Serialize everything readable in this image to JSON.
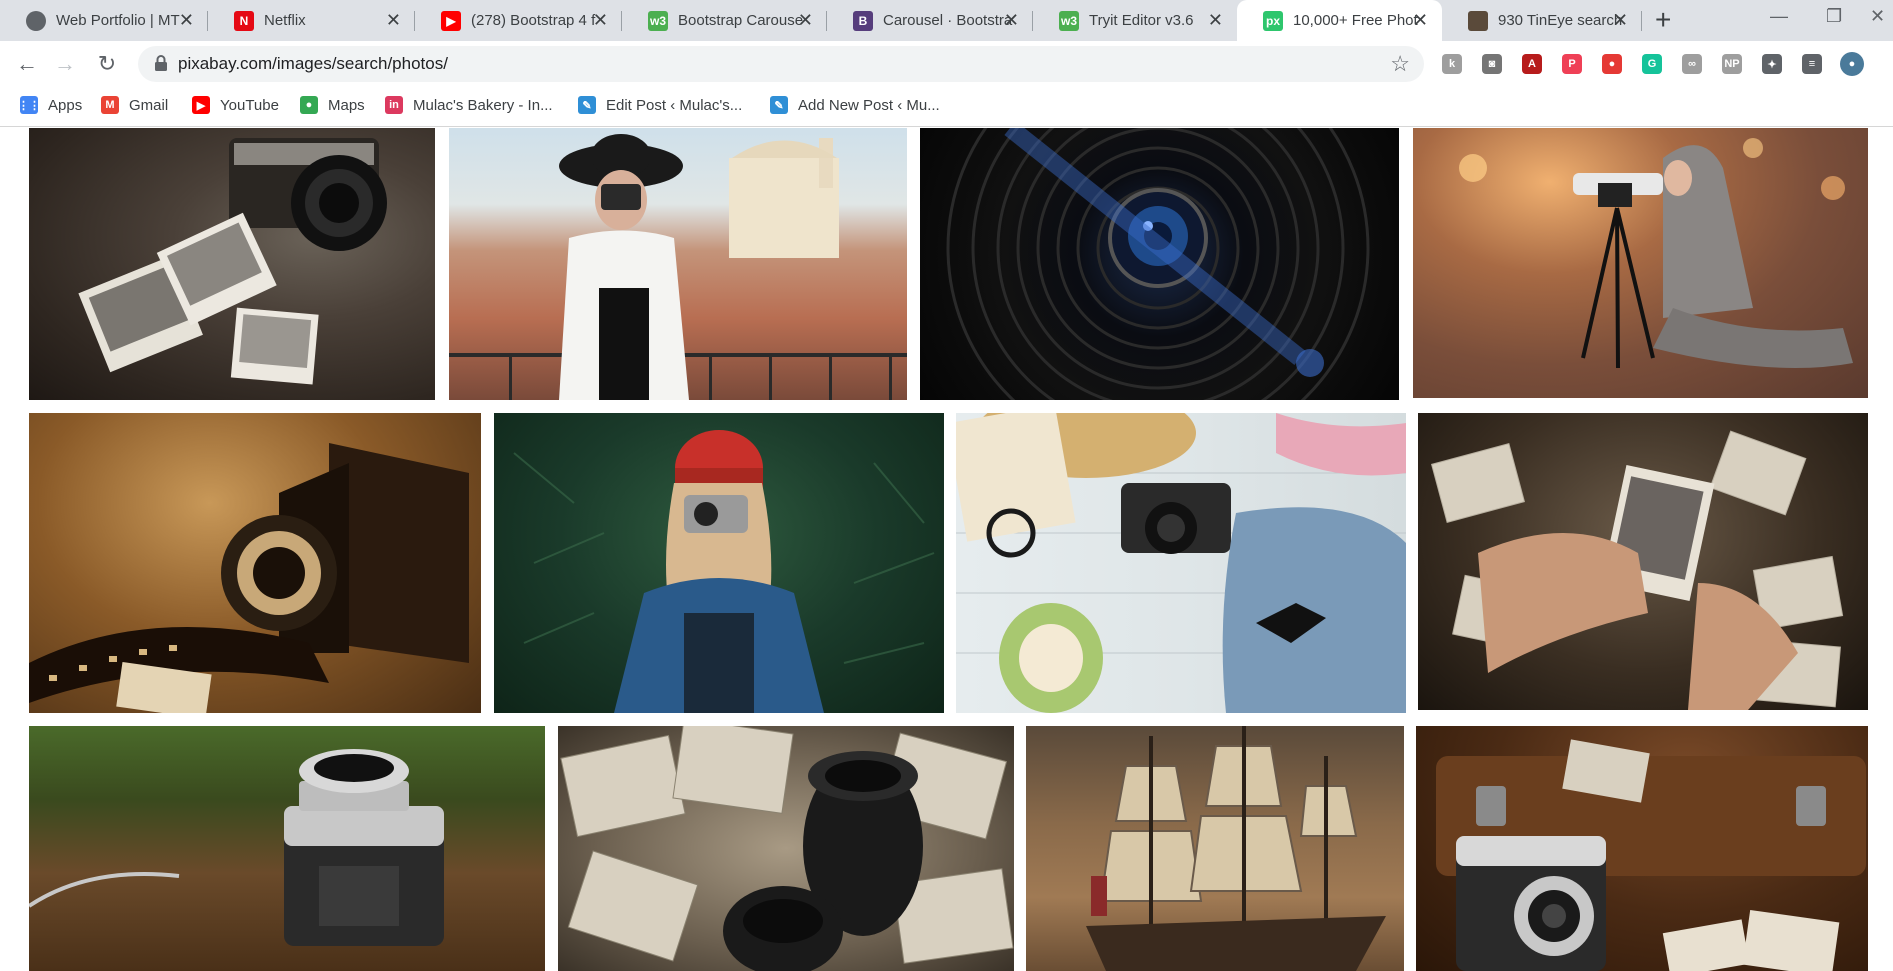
{
  "tabs": [
    {
      "title": "Web Portfolio | MT",
      "icon": "globe-icon",
      "color": "#5f6368",
      "glyph": ""
    },
    {
      "title": "Netflix",
      "icon": "netflix-icon",
      "color": "#e50914",
      "glyph": "N"
    },
    {
      "title": "(278) Bootstrap 4 f",
      "icon": "youtube-icon",
      "color": "#ff0000",
      "glyph": "▶"
    },
    {
      "title": "Bootstrap Carouse",
      "icon": "w3schools-icon",
      "color": "#4caf50",
      "glyph": "w3"
    },
    {
      "title": "Carousel · Bootstra",
      "icon": "bootstrap-icon",
      "color": "#563d7c",
      "glyph": "B"
    },
    {
      "title": "Tryit Editor v3.6",
      "icon": "w3schools-icon",
      "color": "#4caf50",
      "glyph": "w3"
    },
    {
      "title": "10,000+ Free Phot",
      "icon": "pixabay-icon",
      "color": "#2ec66d",
      "glyph": "px",
      "active": true
    },
    {
      "title": "930 TinEye search",
      "icon": "tineye-icon",
      "color": "#5a4a3a",
      "glyph": ""
    }
  ],
  "window_controls": {
    "minimize": "—",
    "restore": "❐",
    "close": "✕",
    "new_tab": "+"
  },
  "toolbar": {
    "back": "←",
    "forward": "→",
    "reload": "↻",
    "url": "pixabay.com/images/search/photos/",
    "star": "☆"
  },
  "extensions": [
    {
      "name": "extension-1-icon",
      "color": "#9e9e9e",
      "glyph": "k"
    },
    {
      "name": "camera-extension-icon",
      "color": "#757575",
      "glyph": "◙"
    },
    {
      "name": "pdf-extension-icon",
      "color": "#b71c1c",
      "glyph": "A"
    },
    {
      "name": "pocket-extension-icon",
      "color": "#ef4056",
      "glyph": "P"
    },
    {
      "name": "adblock-extension-icon",
      "color": "#e53935",
      "glyph": "●"
    },
    {
      "name": "grammarly-extension-icon",
      "color": "#15c39a",
      "glyph": "G"
    },
    {
      "name": "ghost-extension-icon",
      "color": "#9e9e9e",
      "glyph": "∞"
    },
    {
      "name": "np-extension-icon",
      "color": "#9e9e9e",
      "glyph": "NP"
    },
    {
      "name": "puzzle-extensions-icon",
      "color": "#5f6368",
      "glyph": "✦"
    },
    {
      "name": "reading-list-icon",
      "color": "#5f6368",
      "glyph": "≡"
    },
    {
      "name": "profile-avatar",
      "color": "#4a7a9a",
      "glyph": "●"
    }
  ],
  "bookmarks": [
    {
      "label": "Apps",
      "icon": "apps-grid-icon",
      "color": "#4285f4",
      "glyph": "⋮⋮"
    },
    {
      "label": "Gmail",
      "icon": "gmail-icon",
      "color": "#ea4335",
      "glyph": "M"
    },
    {
      "label": "YouTube",
      "icon": "youtube-icon",
      "color": "#ff0000",
      "glyph": "▶"
    },
    {
      "label": "Maps",
      "icon": "maps-pin-icon",
      "color": "#34a853",
      "glyph": "●"
    },
    {
      "label": "Mulac's Bakery - In...",
      "icon": "invision-icon",
      "color": "#dc395f",
      "glyph": "in"
    },
    {
      "label": "Edit Post ‹ Mulac's...",
      "icon": "wordpress-edit-icon",
      "color": "#2f8fd6",
      "glyph": "✎"
    },
    {
      "label": "Add New Post ‹ Mu...",
      "icon": "wordpress-add-icon",
      "color": "#2f8fd6",
      "glyph": "✎"
    }
  ],
  "photos": [
    {
      "name": "vintage-camera-map-photo",
      "description": "Vintage Zenit camera with polaroid photos on a map"
    },
    {
      "name": "woman-hat-camera-photo",
      "description": "Woman in black hat photographing over rooftops"
    },
    {
      "name": "camera-lens-closeup-photo",
      "description": "Close-up of a camera lens with blue flare"
    },
    {
      "name": "woman-tripod-street-photo",
      "description": "Hooded woman with camera on tripod at night"
    },
    {
      "name": "folding-camera-film-photo",
      "description": "Antique folding camera with film strip"
    },
    {
      "name": "red-beanie-woman-camera-photo",
      "description": "Woman in red beanie holding a camera"
    },
    {
      "name": "flatlay-camera-hat-photo",
      "description": "Flat lay with camera, straw hat, sunglasses and coconut"
    },
    {
      "name": "hands-old-photos-photo",
      "description": "Hands holding old black-and-white photographs"
    },
    {
      "name": "silver-camera-table-photo",
      "description": "Silver vintage camera on a wooden table"
    },
    {
      "name": "lenses-old-photos-photo",
      "description": "Camera lenses on a pile of old photos"
    },
    {
      "name": "sailing-ship-photo",
      "description": "Sailing ship with sepia sky"
    },
    {
      "name": "camera-suitcase-photo",
      "description": "Vintage camera in front of an old suitcase"
    }
  ]
}
